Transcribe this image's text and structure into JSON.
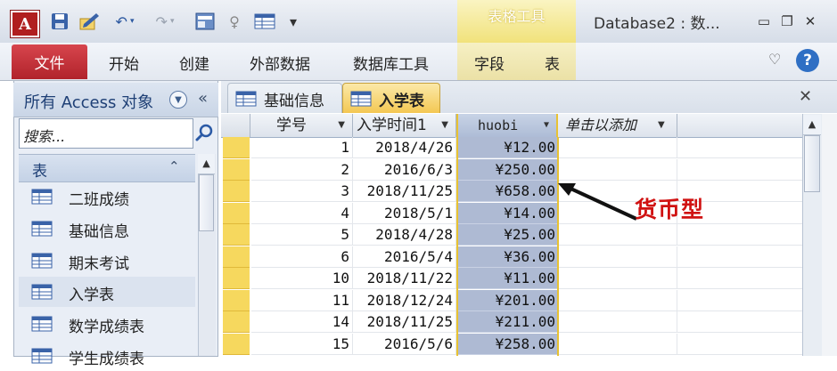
{
  "titlebar": {
    "app_icon": "A",
    "context_title": "表格工具",
    "window_title": "Database2 : 数...",
    "quick_access": [
      "save-icon",
      "edit-icon",
      "undo-icon",
      "redo-icon",
      "form-icon",
      "help-bulb-icon",
      "table-icon",
      "customize-icon"
    ],
    "controls": [
      "minimize-icon",
      "restore-icon",
      "close-icon"
    ]
  },
  "ribbon": {
    "file": "文件",
    "tabs": [
      "开始",
      "创建",
      "外部数据",
      "数据库工具"
    ],
    "context_tabs": [
      "字段",
      "表"
    ],
    "help": "?"
  },
  "nav": {
    "title": "所有 Access 对象",
    "collapse": "«",
    "search_placeholder": "搜索...",
    "group": "表",
    "items": [
      "二班成绩",
      "基础信息",
      "期末考试",
      "入学表",
      "数学成绩表",
      "学生成绩表"
    ],
    "selected": "入学表"
  },
  "documents": {
    "tabs": [
      "基础信息",
      "入学表"
    ],
    "active": "入学表"
  },
  "table": {
    "columns": [
      "学号",
      "入学时间1",
      "huobi",
      "单击以添加"
    ],
    "rows": [
      {
        "id": "1",
        "date": "2018/4/26",
        "money": "¥12.00"
      },
      {
        "id": "2",
        "date": "2016/6/3",
        "money": "¥250.00"
      },
      {
        "id": "3",
        "date": "2018/11/25",
        "money": "¥658.00"
      },
      {
        "id": "4",
        "date": "2018/5/1",
        "money": "¥14.00"
      },
      {
        "id": "5",
        "date": "2018/4/28",
        "money": "¥25.00"
      },
      {
        "id": "6",
        "date": "2016/5/4",
        "money": "¥36.00"
      },
      {
        "id": "10",
        "date": "2018/11/22",
        "money": "¥11.00"
      },
      {
        "id": "11",
        "date": "2018/12/24",
        "money": "¥201.00"
      },
      {
        "id": "14",
        "date": "2018/11/25",
        "money": "¥211.00"
      },
      {
        "id": "15",
        "date": "2016/5/6",
        "money": "¥258.00"
      }
    ]
  },
  "annotation": "货币型",
  "colors": {
    "accent_gold": "#e8c233",
    "selected_column": "#aebad3",
    "annotation": "#d01212",
    "file_tab": "#b1232b"
  }
}
